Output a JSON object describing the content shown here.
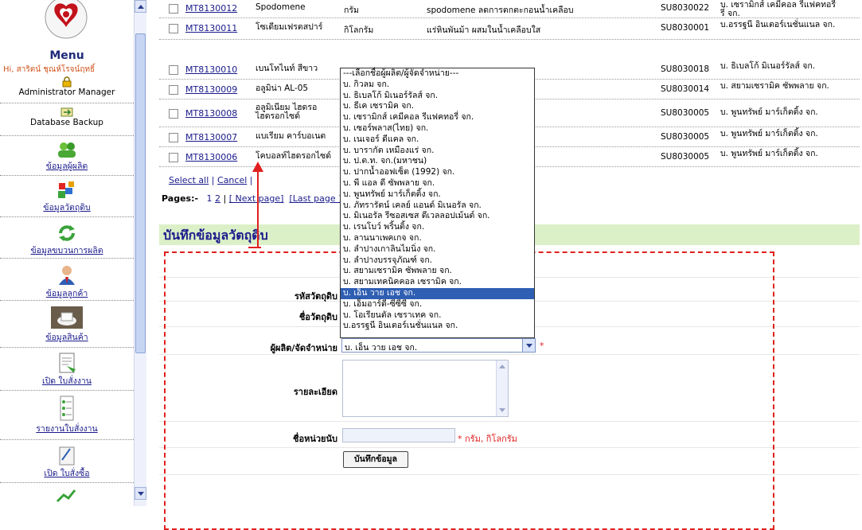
{
  "sidebar": {
    "menu_title": "Menu",
    "greeting": "Hi, สาริตน์ ชุณห์โรจน์ฤทธิ์",
    "items": [
      {
        "label": "Administrator Manager",
        "icon": "lock-icon"
      },
      {
        "label": "Database Backup",
        "icon": "database-icon"
      },
      {
        "label": "ข้อมูลผู้ผลิต",
        "icon": "group-icon"
      },
      {
        "label": "ข้อมูลวัตถุดิบ",
        "icon": "materials-icon"
      },
      {
        "label": "ข้อมูลขบวนการผลิต",
        "icon": "refresh-icon"
      },
      {
        "label": "ข้อมูลลูกค้า",
        "icon": "customer-icon"
      },
      {
        "label": "ข้อมูลสินค้า",
        "icon": "product-icon"
      },
      {
        "label": "เปิด ใบสั่งงาน",
        "icon": "open-order-icon"
      },
      {
        "label": "รายงานใบสั่งงาน",
        "icon": "report-icon"
      },
      {
        "label": "เปิด ใบสั่งซื้อ",
        "icon": "purchase-icon"
      }
    ]
  },
  "table": {
    "rows": [
      {
        "code": "MT8130012",
        "name": "Spodomene",
        "unit": "กรัม",
        "desc": "spodomene ลดการตกตะกอนน้ำเคลือบ",
        "sup": "SU8030022",
        "supname": "บ. เซรามิกส์ เคมีคอล รีแฟคทอรี่ รี่ จก."
      },
      {
        "code": "MT8130011",
        "name": "โซเดียมเฟรตสปาร์",
        "unit": "กิโลกรัม",
        "desc": "แร่หินพันม้า ผสมในน้ำเคลือบใส",
        "sup": "SU8030001",
        "supname": "บ.อรรฐนี อินเตอร์เนชั่นแนล จก."
      },
      {
        "code": "MT8130010",
        "name": "เบนโทไนท์ สีขาว",
        "unit": "",
        "desc": "",
        "sup": "SU8030018",
        "supname": "บ. ธิเบลโก้ มิเนอร์รัลส์ จก."
      },
      {
        "code": "MT8130009",
        "name": "อลูมิน่า AL-05",
        "unit": "",
        "desc": "",
        "sup": "SU8030014",
        "supname": "บ. สยามเซรามิค ซัพพลาย จก."
      },
      {
        "code": "MT8130008",
        "name": "อลูมิเนียม ไฮดรอ ไฮดรอกไซด์",
        "unit": "",
        "desc": "",
        "sup": "SU8030005",
        "supname": "บ. พูนทรัพย์ มาร์เก็ตติ้ง จก."
      },
      {
        "code": "MT8130007",
        "name": "แบเรียม คาร์บอเนต",
        "unit": "",
        "desc": "",
        "sup": "SU8030005",
        "supname": "บ. พูนทรัพย์ มาร์เก็ตติ้ง จก."
      },
      {
        "code": "MT8130006",
        "name": "โคบอลท์ไฮดรอกไซด์",
        "unit": "",
        "desc": "",
        "sup": "SU8030005",
        "supname": "บ. พูนทรัพย์ มาร์เก็ตติ้ง จก."
      }
    ]
  },
  "select_links": {
    "select_all": "Select all",
    "sep": "|",
    "cancel": "Cancel",
    "end": "|"
  },
  "pages": {
    "label": "Pages:-",
    "page1": "1",
    "page2": "2",
    "sep": "|",
    "next": "[ Next page]",
    "last": "[Last page ]"
  },
  "section_title": "บันทึกข้อมูลวัตถุดิบ",
  "form": {
    "code_label": "รหัสวัตถุดิบ",
    "name_label": "ชื่อวัตถุดิบ",
    "supplier_label": "ผู้ผลิต/จัดจำหน่าย",
    "supplier_selected": "บ. เอ็น วาย เอช จก.",
    "detail_label": "รายละเอียด",
    "unit_label": "ชื่อหน่วยนับ",
    "unit_note": "* กรัม, กิโลกรัม",
    "required_mark": "*",
    "save_button": "บันทึกข้อมูล"
  },
  "dropdown": {
    "options": [
      "---เลือกชื่อผู้ผลิต/ผู้จัดจำหน่าย---",
      "บ. กิวลม จก.",
      "บ. ธิเบลโก้ มิเนอร์รัลส์ จก.",
      "บ. ธีเค เซรามิค จก.",
      "บ. เซรามิกส์ เคมีคอล รีแฟคทอรี่ จก.",
      "บ. เซอร์พลาส(ไทย) จก.",
      "บ. เนเจอร์ ดีแคล จก.",
      "บ. บารากัต เหมืองแร่ จก.",
      "บ. ป.ต.ท. จก.(มหาชน)",
      "บ. ปากน้ำออฟเซ็ต (1992) จก.",
      "บ. พี แอล ดี ซัพพลาย จก.",
      "บ. พูนทรัพย์ มาร์เก็ตติ้ง จก.",
      "บ. ภัทรารัตน์ เคลย์ แอนด์ มิเนอรัล จก.",
      "บ. มิเนอรัล รีซอสเซส ดีเวลลอปเม้นต์ จก.",
      "บ. เรนโบว์ พริ้นติ้ง จก.",
      "บ. ลานนาเพคเกจ จก.",
      "บ. ลำปางเกาลินไมนิ่ง จก.",
      "บ. ลำปางบรรจุภัณฑ์ จก.",
      "บ. สยามเซรามิค ซัพพลาย จก.",
      "บ. สยามเทคนิคคอล เซรามิค จก.",
      "บ. เอ็น วาย เอช จก.",
      "บ. เอ็มอาร์ดี-ซีซีซี จก.",
      "บ. โอเรียนตัล เซราเทค จก.",
      "บ.อรรฐนี อินเตอร์เนชั่นแนล จก."
    ],
    "selected_index": 20
  },
  "colors": {
    "accent": "#1a1a8c",
    "section_bg": "#dcf0c8",
    "required": "#e0201f",
    "selection": "#2f5fb3"
  }
}
